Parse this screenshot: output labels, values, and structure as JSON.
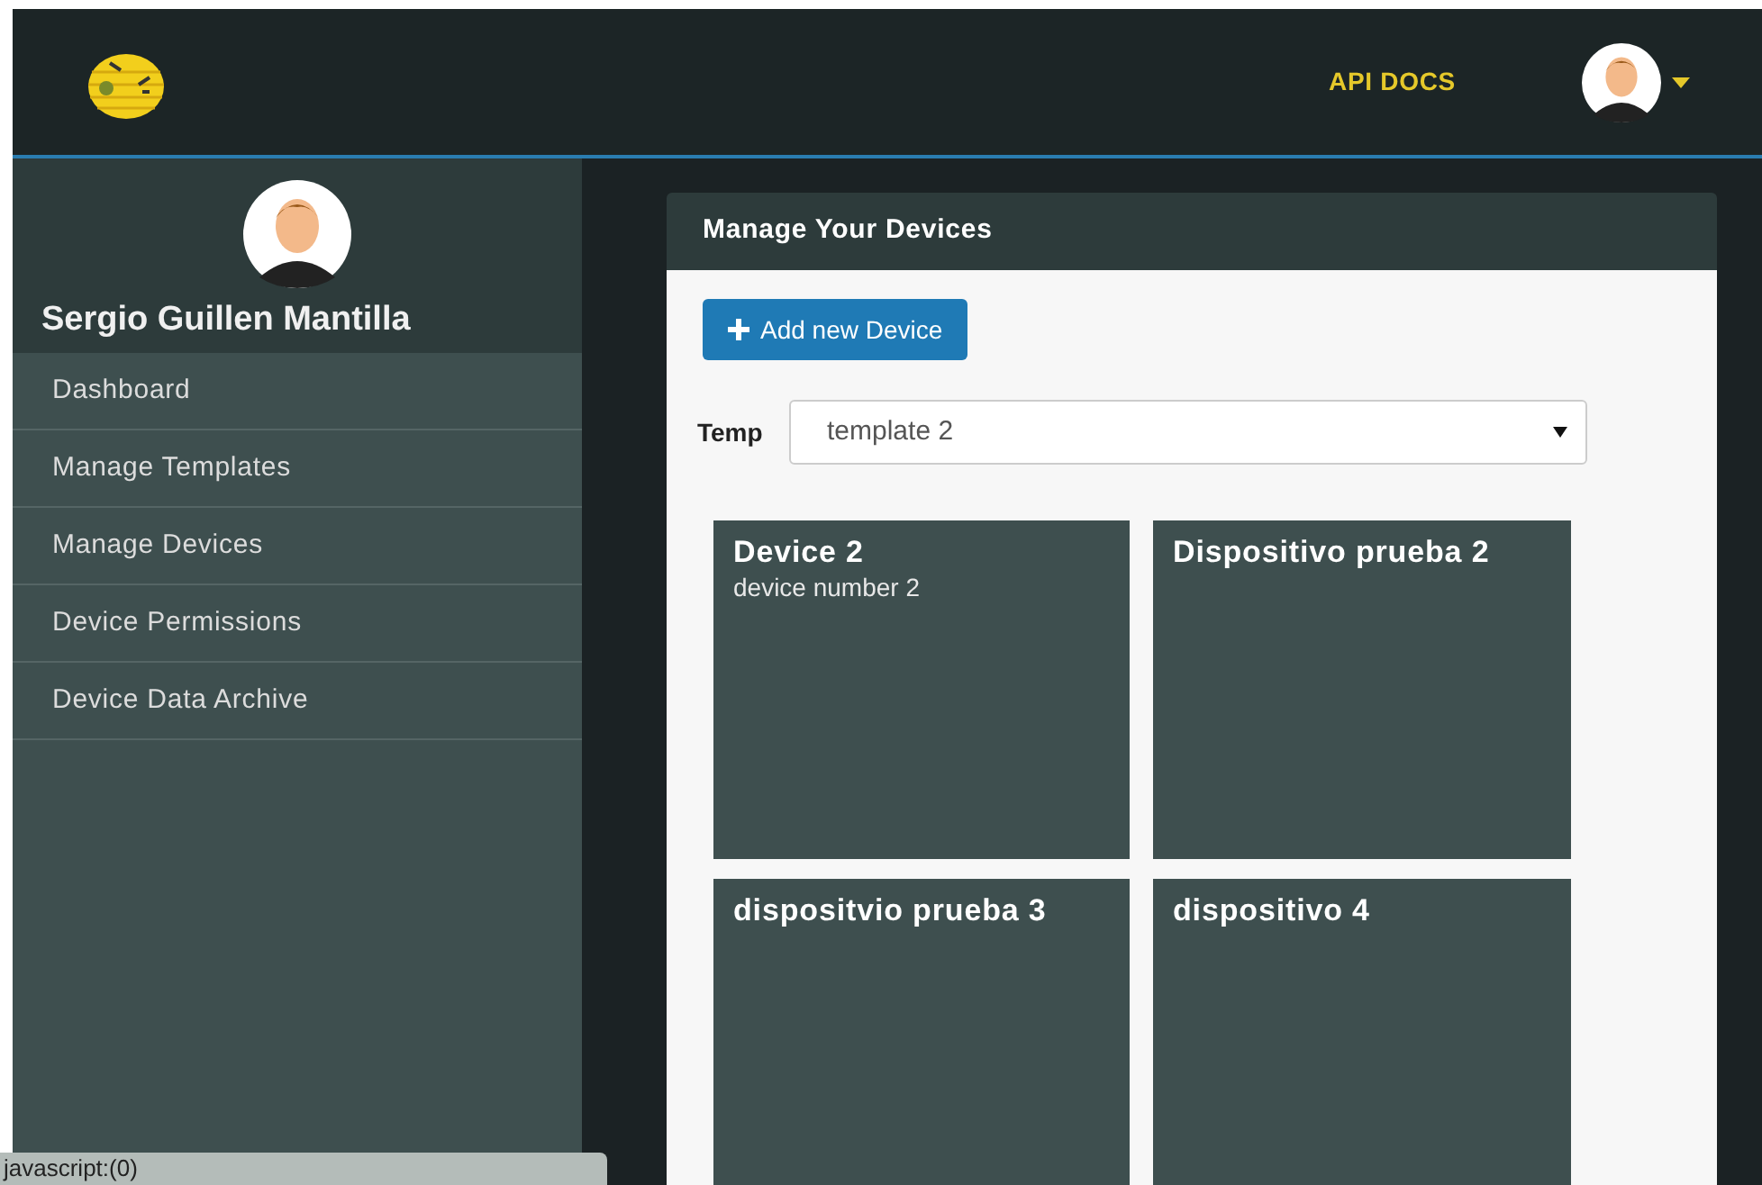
{
  "header": {
    "api_link": "API DOCS"
  },
  "sidebar": {
    "user_name": "Sergio Guillen Mantilla",
    "items": [
      {
        "label": "Dashboard",
        "selected": false
      },
      {
        "label": "Manage Templates",
        "selected": false
      },
      {
        "label": "Manage Devices",
        "selected": false
      },
      {
        "label": "Device Permissions",
        "selected": false
      },
      {
        "label": "Device Data Archive",
        "selected": false
      }
    ]
  },
  "panel": {
    "title": "Manage Your Devices",
    "add_button": "Add new Device",
    "template_label": "Temp",
    "template_value": "template 2",
    "devices": [
      {
        "name": "Device 2",
        "description": "device number 2"
      },
      {
        "name": "Dispositivo prueba 2"
      },
      {
        "name": "dispositvio prueba 3"
      },
      {
        "name": "dispositivo 4"
      }
    ]
  },
  "status_bar": "javascript:(0)"
}
